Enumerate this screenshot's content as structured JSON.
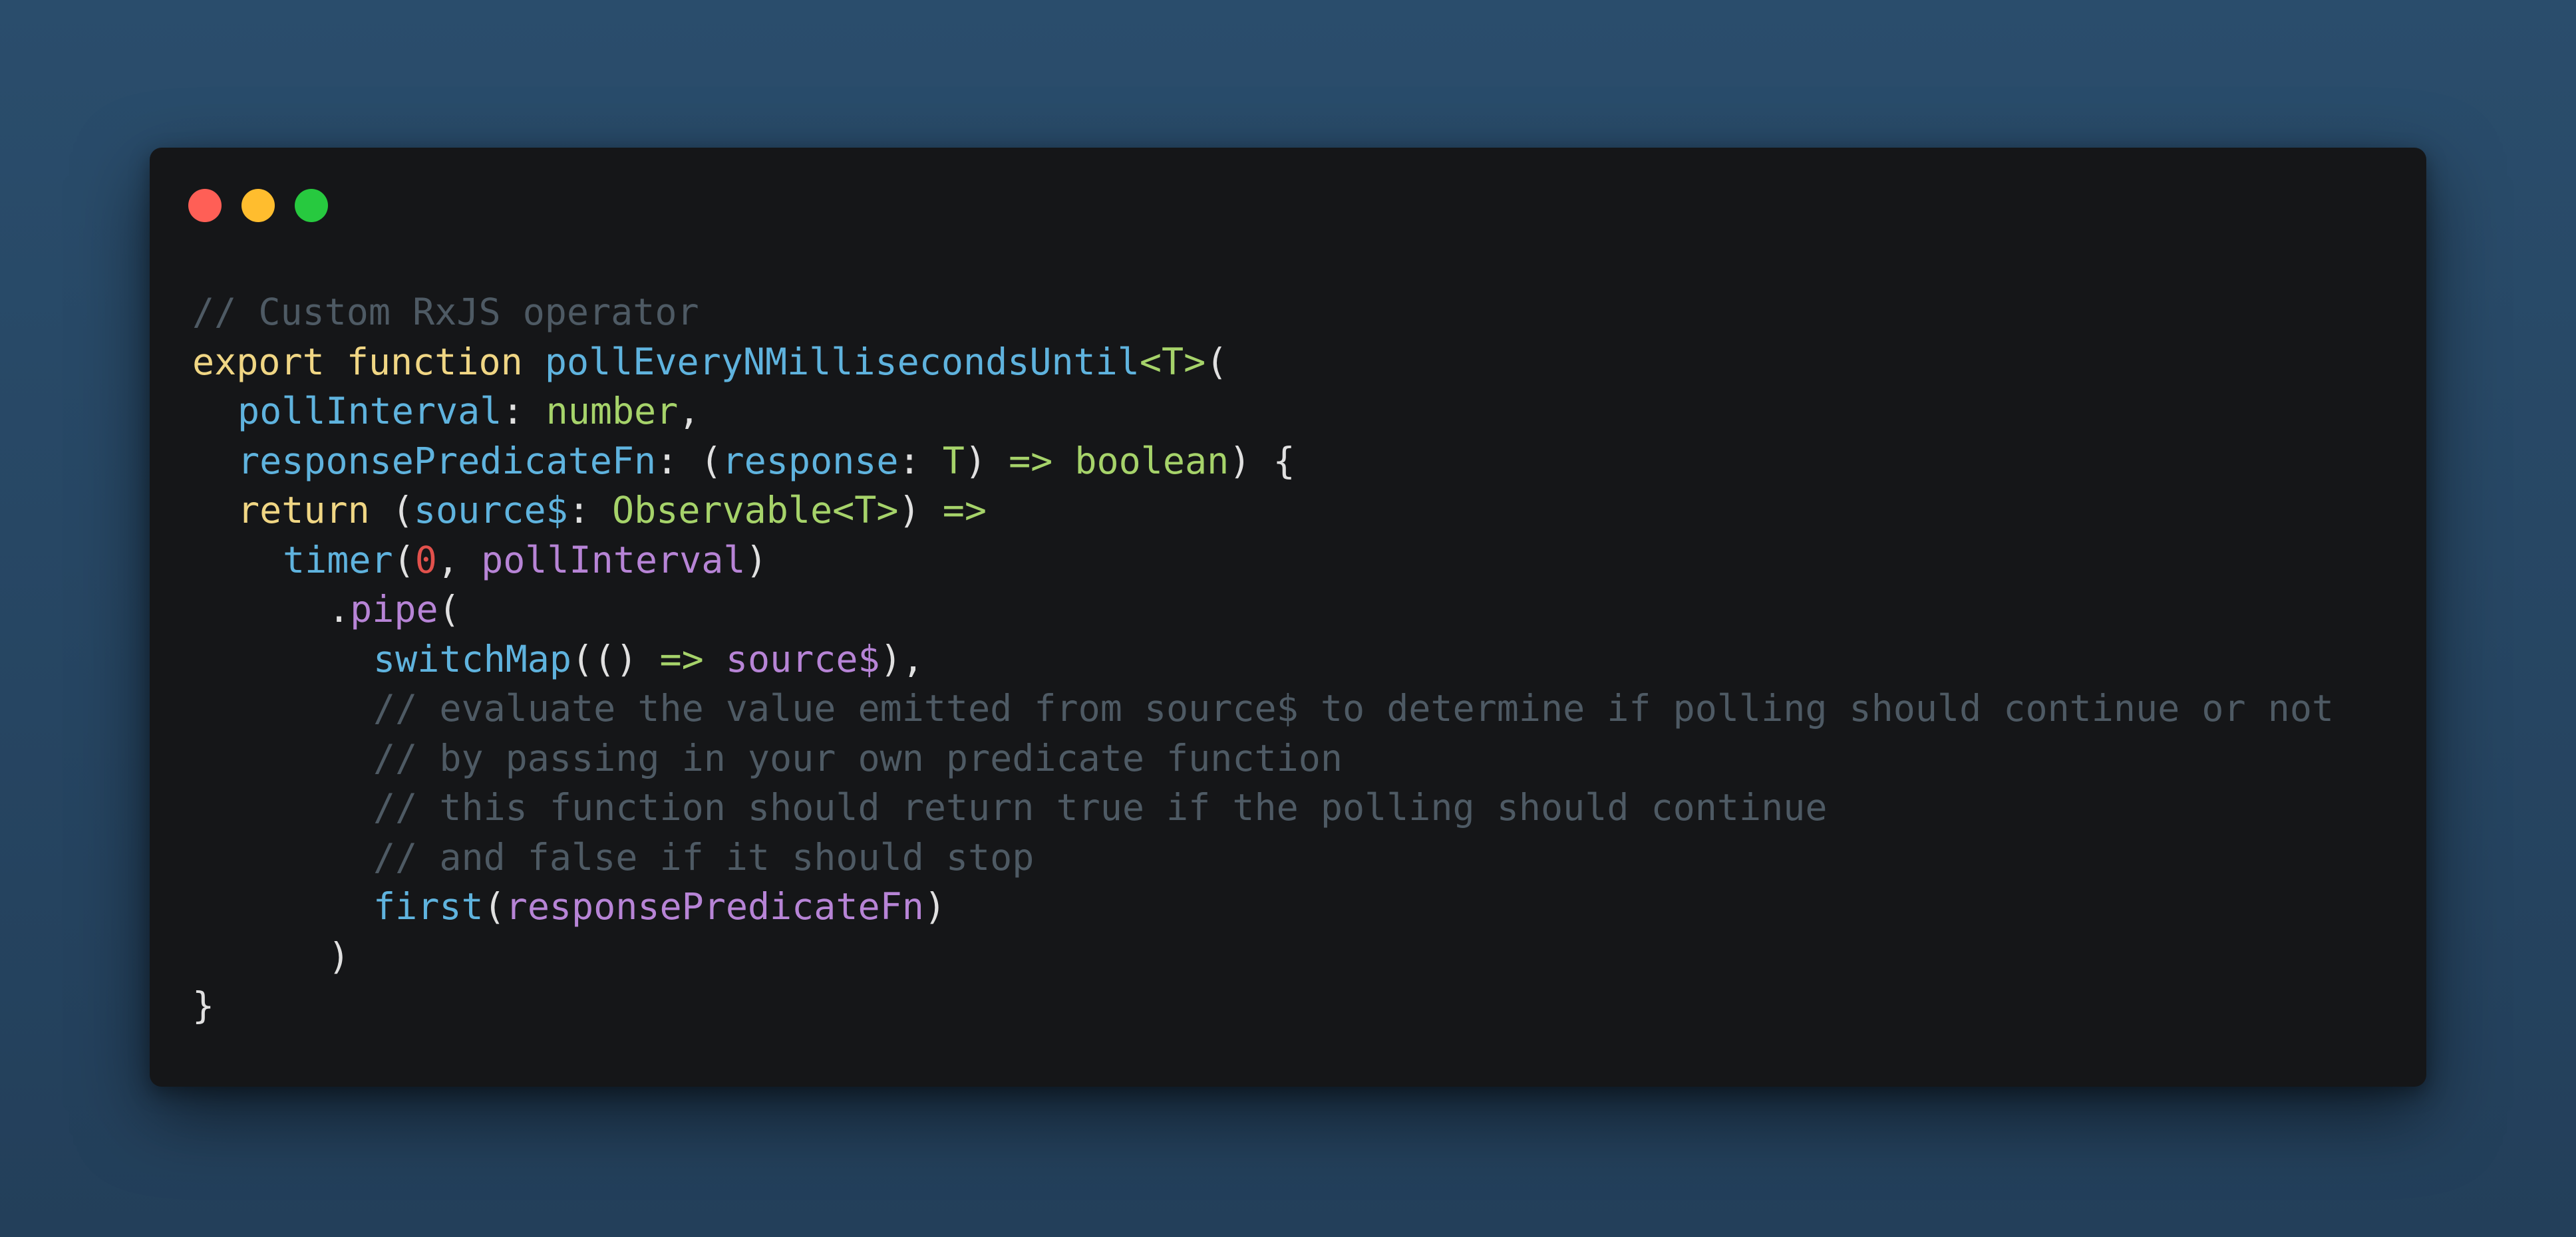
{
  "window": {
    "controls": {
      "close_color": "#ff5f56",
      "minimize_color": "#ffbd2e",
      "maximize_color": "#27c93f"
    }
  },
  "code": {
    "line1": {
      "comment": "// Custom RxJS operator"
    },
    "line2": {
      "kw_export": "export",
      "kw_function": "function",
      "fn_name": "pollEveryNMillisecondsUntil",
      "generic": "<T>",
      "open": "("
    },
    "line3": {
      "param": "pollInterval",
      "colon": ":",
      "type": "number",
      "comma": ","
    },
    "line4": {
      "param": "responsePredicateFn",
      "colon": ":",
      "open": "(",
      "arg": "response",
      "colon2": ":",
      "type_t": "T",
      "close": ")",
      "arrow": "=>",
      "type_bool": "boolean",
      "close2": ")",
      "brace": "{"
    },
    "line5": {
      "kw_return": "return",
      "open": "(",
      "arg": "source$",
      "colon": ":",
      "type": "Observable<T>",
      "close": ")",
      "arrow": "=>"
    },
    "line6": {
      "fn": "timer",
      "open": "(",
      "num": "0",
      "comma": ",",
      "arg": "pollInterval",
      "close": ")"
    },
    "line7": {
      "dot": ".",
      "method": "pipe",
      "open": "("
    },
    "line8": {
      "fn": "switchMap",
      "open": "(()",
      "arrow": "=>",
      "arg": "source$",
      "close": "),"
    },
    "line9": {
      "comment": "// evaluate the value emitted from source$ to determine if polling should continue or not"
    },
    "line10": {
      "comment": "// by passing in your own predicate function"
    },
    "line11": {
      "comment": "// this function should return true if the polling should continue"
    },
    "line12": {
      "comment": "// and false if it should stop"
    },
    "line13": {
      "fn": "first",
      "open": "(",
      "arg": "responsePredicateFn",
      "close": ")"
    },
    "line14": {
      "close": ")"
    },
    "line15": {
      "brace": "}"
    }
  }
}
